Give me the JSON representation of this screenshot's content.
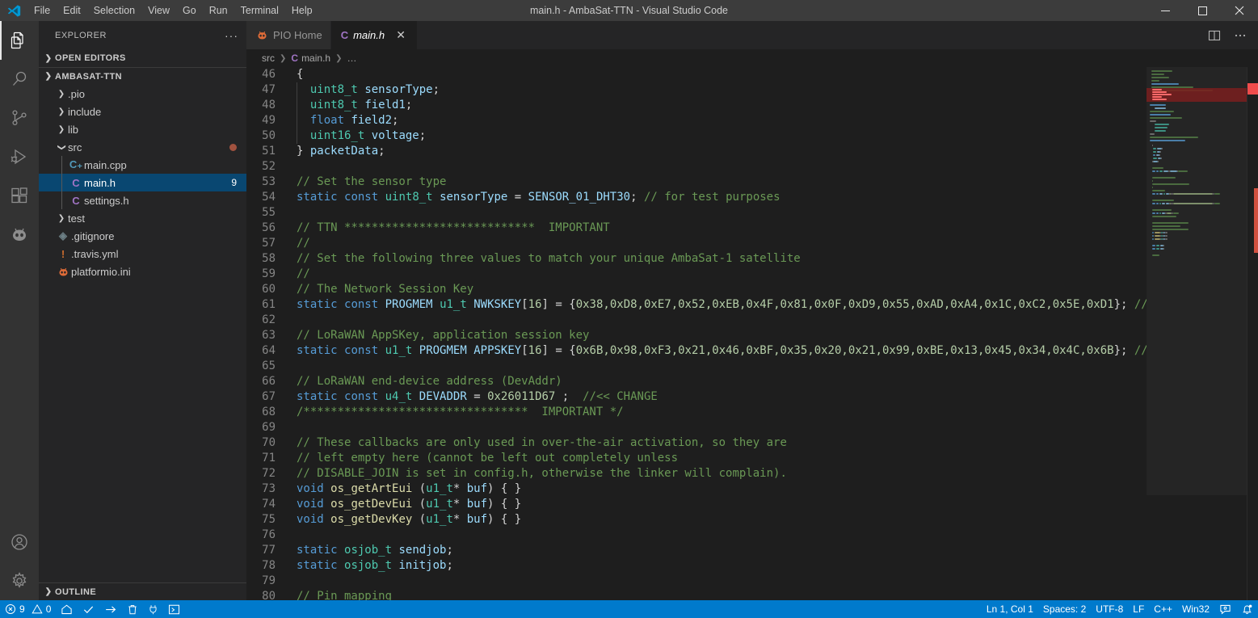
{
  "window": {
    "title": "main.h - AmbaSat-TTN - Visual Studio Code",
    "minimize_label": "Minimize",
    "maximize_label": "Maximize",
    "close_label": "Close"
  },
  "menubar": {
    "items": [
      {
        "label": "File"
      },
      {
        "label": "Edit"
      },
      {
        "label": "Selection"
      },
      {
        "label": "View"
      },
      {
        "label": "Go"
      },
      {
        "label": "Run"
      },
      {
        "label": "Terminal"
      },
      {
        "label": "Help"
      }
    ]
  },
  "activitybar": {
    "items": [
      {
        "name": "explorer",
        "icon": "files-icon",
        "active": true
      },
      {
        "name": "search",
        "icon": "search-icon",
        "active": false
      },
      {
        "name": "source-control",
        "icon": "source-control-icon",
        "active": false
      },
      {
        "name": "run-and-debug",
        "icon": "run-debug-icon",
        "active": false
      },
      {
        "name": "extensions",
        "icon": "extensions-icon",
        "active": false
      },
      {
        "name": "platformio",
        "icon": "platformio-alien-icon",
        "active": false
      }
    ],
    "bottom": [
      {
        "name": "accounts",
        "icon": "account-icon"
      },
      {
        "name": "manage",
        "icon": "gear-icon"
      }
    ]
  },
  "sidebar": {
    "title": "EXPLORER",
    "more_actions": "···",
    "sections": [
      {
        "label": "OPEN EDITORS",
        "expanded": false
      },
      {
        "label": "OUTLINE",
        "expanded": false
      }
    ],
    "project": {
      "label": "AMBASAT-TTN",
      "expanded": true
    },
    "tree": [
      {
        "label": ".pio",
        "type": "folder",
        "expanded": false,
        "indent": 1,
        "icon": "chevron-right-icon"
      },
      {
        "label": "include",
        "type": "folder",
        "expanded": false,
        "indent": 1,
        "icon": "chevron-right-icon"
      },
      {
        "label": "lib",
        "type": "folder",
        "expanded": false,
        "indent": 1,
        "icon": "chevron-right-icon"
      },
      {
        "label": "src",
        "type": "folder",
        "expanded": true,
        "indent": 1,
        "icon": "chevron-down-icon",
        "dot": true
      },
      {
        "label": "main.cpp",
        "type": "file",
        "ext": "cpp",
        "indent": 2,
        "glyph": "C₊"
      },
      {
        "label": "main.h",
        "type": "file",
        "ext": "h",
        "indent": 2,
        "glyph": "C",
        "selected": true,
        "badge": "9"
      },
      {
        "label": "settings.h",
        "type": "file",
        "ext": "h",
        "indent": 2,
        "glyph": "C"
      },
      {
        "label": "test",
        "type": "folder",
        "expanded": false,
        "indent": 1,
        "icon": "chevron-right-icon"
      },
      {
        "label": ".gitignore",
        "type": "file",
        "ext": "git",
        "indent": 1,
        "glyph": "◈"
      },
      {
        "label": ".travis.yml",
        "type": "file",
        "ext": "yml",
        "indent": 1,
        "glyph": "!"
      },
      {
        "label": "platformio.ini",
        "type": "file",
        "ext": "ini",
        "indent": 1,
        "glyph": "👽"
      }
    ]
  },
  "editor": {
    "tabs": [
      {
        "label": "PIO Home",
        "icon": "platformio-alien-icon",
        "active": false,
        "preview": false,
        "closable": false
      },
      {
        "label": "main.h",
        "icon": "c-header-icon",
        "active": true,
        "preview": true,
        "closable": true,
        "close_label": "✕"
      }
    ],
    "actions": [
      {
        "name": "split-editor-right",
        "icon": "split-editor-icon"
      },
      {
        "name": "more-editor-actions",
        "icon": "ellipsis-icon"
      }
    ],
    "breadcrumbs": [
      {
        "label": "src",
        "icon": null
      },
      {
        "label": "main.h",
        "icon": "c-header-icon"
      },
      {
        "label": "…",
        "icon": null
      }
    ],
    "first_line_number": 46,
    "lines": [
      {
        "n": 46,
        "tokens": [
          {
            "t": "{",
            "c": "p"
          }
        ]
      },
      {
        "n": 47,
        "indent": true,
        "tokens": [
          {
            "t": "  ",
            "c": "p"
          },
          {
            "t": "uint8_t",
            "c": "t"
          },
          {
            "t": " ",
            "c": "p"
          },
          {
            "t": "sensorType",
            "c": "v"
          },
          {
            "t": ";",
            "c": "p"
          }
        ]
      },
      {
        "n": 48,
        "indent": true,
        "tokens": [
          {
            "t": "  ",
            "c": "p"
          },
          {
            "t": "uint8_t",
            "c": "t"
          },
          {
            "t": " ",
            "c": "p"
          },
          {
            "t": "field1",
            "c": "v"
          },
          {
            "t": ";",
            "c": "p"
          }
        ]
      },
      {
        "n": 49,
        "indent": true,
        "tokens": [
          {
            "t": "  ",
            "c": "p"
          },
          {
            "t": "float",
            "c": "k"
          },
          {
            "t": " ",
            "c": "p"
          },
          {
            "t": "field2",
            "c": "v"
          },
          {
            "t": ";",
            "c": "p"
          }
        ]
      },
      {
        "n": 50,
        "indent": true,
        "tokens": [
          {
            "t": "  ",
            "c": "p"
          },
          {
            "t": "uint16_t",
            "c": "t"
          },
          {
            "t": " ",
            "c": "p"
          },
          {
            "t": "voltage",
            "c": "v"
          },
          {
            "t": ";",
            "c": "p"
          }
        ]
      },
      {
        "n": 51,
        "tokens": [
          {
            "t": "} ",
            "c": "p"
          },
          {
            "t": "packetData",
            "c": "v"
          },
          {
            "t": ";",
            "c": "p"
          }
        ]
      },
      {
        "n": 52,
        "tokens": []
      },
      {
        "n": 53,
        "tokens": [
          {
            "t": "// Set the sensor type",
            "c": "c"
          }
        ]
      },
      {
        "n": 54,
        "tokens": [
          {
            "t": "static",
            "c": "k"
          },
          {
            "t": " ",
            "c": "p"
          },
          {
            "t": "const",
            "c": "k"
          },
          {
            "t": " ",
            "c": "p"
          },
          {
            "t": "uint8_t",
            "c": "t"
          },
          {
            "t": " ",
            "c": "p"
          },
          {
            "t": "sensorType",
            "c": "v"
          },
          {
            "t": " = ",
            "c": "p"
          },
          {
            "t": "SENSOR_01_DHT30",
            "c": "v"
          },
          {
            "t": "; ",
            "c": "p"
          },
          {
            "t": "// for test purposes",
            "c": "c"
          }
        ]
      },
      {
        "n": 55,
        "tokens": []
      },
      {
        "n": 56,
        "tokens": [
          {
            "t": "// TTN ****************************  IMPORTANT",
            "c": "c"
          }
        ]
      },
      {
        "n": 57,
        "tokens": [
          {
            "t": "//",
            "c": "c"
          }
        ]
      },
      {
        "n": 58,
        "tokens": [
          {
            "t": "// Set the following three values to match your unique AmbaSat-1 satellite",
            "c": "c"
          }
        ]
      },
      {
        "n": 59,
        "tokens": [
          {
            "t": "//",
            "c": "c"
          }
        ]
      },
      {
        "n": 60,
        "tokens": [
          {
            "t": "// The Network Session Key",
            "c": "c"
          }
        ]
      },
      {
        "n": 61,
        "tokens": [
          {
            "t": "static",
            "c": "k"
          },
          {
            "t": " ",
            "c": "p"
          },
          {
            "t": "const",
            "c": "k"
          },
          {
            "t": " ",
            "c": "p"
          },
          {
            "t": "PROGMEM",
            "c": "v"
          },
          {
            "t": " ",
            "c": "p"
          },
          {
            "t": "u1_t",
            "c": "t"
          },
          {
            "t": " ",
            "c": "p"
          },
          {
            "t": "NWKSKEY",
            "c": "v"
          },
          {
            "t": "[",
            "c": "p"
          },
          {
            "t": "16",
            "c": "n"
          },
          {
            "t": "] = {",
            "c": "p"
          },
          {
            "t": "0x38,0xD8,0xE7,0x52,0xEB,0x4F,0x81,0x0F,0xD9,0x55,0xAD,0xA4,0x1C,0xC2,0x5E,0xD1",
            "c": "n"
          },
          {
            "t": "}; ",
            "c": "p"
          },
          {
            "t": "//<< CHANGE",
            "c": "c"
          }
        ]
      },
      {
        "n": 62,
        "tokens": []
      },
      {
        "n": 63,
        "tokens": [
          {
            "t": "// LoRaWAN AppSKey, application session key",
            "c": "c"
          }
        ]
      },
      {
        "n": 64,
        "tokens": [
          {
            "t": "static",
            "c": "k"
          },
          {
            "t": " ",
            "c": "p"
          },
          {
            "t": "const",
            "c": "k"
          },
          {
            "t": " ",
            "c": "p"
          },
          {
            "t": "u1_t",
            "c": "t"
          },
          {
            "t": " ",
            "c": "p"
          },
          {
            "t": "PROGMEM",
            "c": "v"
          },
          {
            "t": " ",
            "c": "p"
          },
          {
            "t": "APPSKEY",
            "c": "v"
          },
          {
            "t": "[",
            "c": "p"
          },
          {
            "t": "16",
            "c": "n"
          },
          {
            "t": "] = {",
            "c": "p"
          },
          {
            "t": "0x6B,0x98,0xF3,0x21,0x46,0xBF,0x35,0x20,0x21,0x99,0xBE,0x13,0x45,0x34,0x4C,0x6B",
            "c": "n"
          },
          {
            "t": "}; ",
            "c": "p"
          },
          {
            "t": "//<< CHANGE",
            "c": "c"
          }
        ]
      },
      {
        "n": 65,
        "tokens": []
      },
      {
        "n": 66,
        "tokens": [
          {
            "t": "// LoRaWAN end-device address (DevAddr)",
            "c": "c"
          }
        ]
      },
      {
        "n": 67,
        "tokens": [
          {
            "t": "static",
            "c": "k"
          },
          {
            "t": " ",
            "c": "p"
          },
          {
            "t": "const",
            "c": "k"
          },
          {
            "t": " ",
            "c": "p"
          },
          {
            "t": "u4_t",
            "c": "t"
          },
          {
            "t": " ",
            "c": "p"
          },
          {
            "t": "DEVADDR",
            "c": "v"
          },
          {
            "t": " = ",
            "c": "p"
          },
          {
            "t": "0x26011D67",
            "c": "n"
          },
          {
            "t": " ;  ",
            "c": "p"
          },
          {
            "t": "//<< CHANGE",
            "c": "c"
          }
        ]
      },
      {
        "n": 68,
        "tokens": [
          {
            "t": "/*********************************  IMPORTANT */",
            "c": "c"
          }
        ]
      },
      {
        "n": 69,
        "tokens": []
      },
      {
        "n": 70,
        "tokens": [
          {
            "t": "// These callbacks are only used in over-the-air activation, so they are",
            "c": "c"
          }
        ]
      },
      {
        "n": 71,
        "tokens": [
          {
            "t": "// left empty here (cannot be left out completely unless",
            "c": "c"
          }
        ]
      },
      {
        "n": 72,
        "tokens": [
          {
            "t": "// DISABLE_JOIN is set in config.h, otherwise the linker will complain).",
            "c": "c"
          }
        ]
      },
      {
        "n": 73,
        "tokens": [
          {
            "t": "void",
            "c": "k"
          },
          {
            "t": " ",
            "c": "p"
          },
          {
            "t": "os_getArtEui",
            "c": "f"
          },
          {
            "t": " (",
            "c": "p"
          },
          {
            "t": "u1_t",
            "c": "t"
          },
          {
            "t": "* ",
            "c": "p"
          },
          {
            "t": "buf",
            "c": "v"
          },
          {
            "t": ") { }",
            "c": "p"
          }
        ]
      },
      {
        "n": 74,
        "tokens": [
          {
            "t": "void",
            "c": "k"
          },
          {
            "t": " ",
            "c": "p"
          },
          {
            "t": "os_getDevEui",
            "c": "f"
          },
          {
            "t": " (",
            "c": "p"
          },
          {
            "t": "u1_t",
            "c": "t"
          },
          {
            "t": "* ",
            "c": "p"
          },
          {
            "t": "buf",
            "c": "v"
          },
          {
            "t": ") { }",
            "c": "p"
          }
        ]
      },
      {
        "n": 75,
        "tokens": [
          {
            "t": "void",
            "c": "k"
          },
          {
            "t": " ",
            "c": "p"
          },
          {
            "t": "os_getDevKey",
            "c": "f"
          },
          {
            "t": " (",
            "c": "p"
          },
          {
            "t": "u1_t",
            "c": "t"
          },
          {
            "t": "* ",
            "c": "p"
          },
          {
            "t": "buf",
            "c": "v"
          },
          {
            "t": ") { }",
            "c": "p"
          }
        ]
      },
      {
        "n": 76,
        "tokens": []
      },
      {
        "n": 77,
        "tokens": [
          {
            "t": "static",
            "c": "k"
          },
          {
            "t": " ",
            "c": "p"
          },
          {
            "t": "osjob_t",
            "c": "t"
          },
          {
            "t": " ",
            "c": "p"
          },
          {
            "t": "sendjob",
            "c": "v"
          },
          {
            "t": ";",
            "c": "p"
          }
        ]
      },
      {
        "n": 78,
        "tokens": [
          {
            "t": "static",
            "c": "k"
          },
          {
            "t": " ",
            "c": "p"
          },
          {
            "t": "osjob_t",
            "c": "t"
          },
          {
            "t": " ",
            "c": "p"
          },
          {
            "t": "initjob",
            "c": "v"
          },
          {
            "t": ";",
            "c": "p"
          }
        ]
      },
      {
        "n": 79,
        "tokens": []
      },
      {
        "n": 80,
        "tokens": [
          {
            "t": "// Pin mapping",
            "c": "c"
          }
        ]
      }
    ]
  },
  "statusbar": {
    "left": [
      {
        "name": "problems",
        "icon": "error-icon",
        "value": "9",
        "icon2": "warning-icon",
        "value2": "0"
      },
      {
        "name": "pio-home",
        "icon": "home-icon"
      },
      {
        "name": "pio-build",
        "icon": "check-icon"
      },
      {
        "name": "pio-upload",
        "icon": "arrow-right-icon"
      },
      {
        "name": "pio-clean",
        "icon": "trash-icon"
      },
      {
        "name": "pio-serial-monitor",
        "icon": "plug-icon"
      },
      {
        "name": "pio-new-terminal",
        "icon": "terminal-icon"
      }
    ],
    "right": [
      {
        "name": "cursor-position",
        "label": "Ln 1, Col 1"
      },
      {
        "name": "indentation",
        "label": "Spaces: 2"
      },
      {
        "name": "encoding",
        "label": "UTF-8"
      },
      {
        "name": "eol",
        "label": "LF"
      },
      {
        "name": "language-mode",
        "label": "C++"
      },
      {
        "name": "platform",
        "label": "Win32"
      },
      {
        "name": "feedback",
        "icon": "feedback-icon"
      },
      {
        "name": "notifications",
        "icon": "bell-dot-icon"
      }
    ]
  },
  "colors": {
    "accent": "#007acc",
    "selection": "#094771",
    "editor_bg": "#1e1e1e",
    "sidebar_bg": "#252526",
    "activitybar_bg": "#333333",
    "titlebar_bg": "#3c3c3c",
    "error": "#f14c4c",
    "keyword": "#569cd6",
    "type": "#4ec9b0",
    "comment": "#6a9955",
    "variable": "#9cdcfe",
    "number": "#b5cea8",
    "function": "#dcdcaa"
  }
}
